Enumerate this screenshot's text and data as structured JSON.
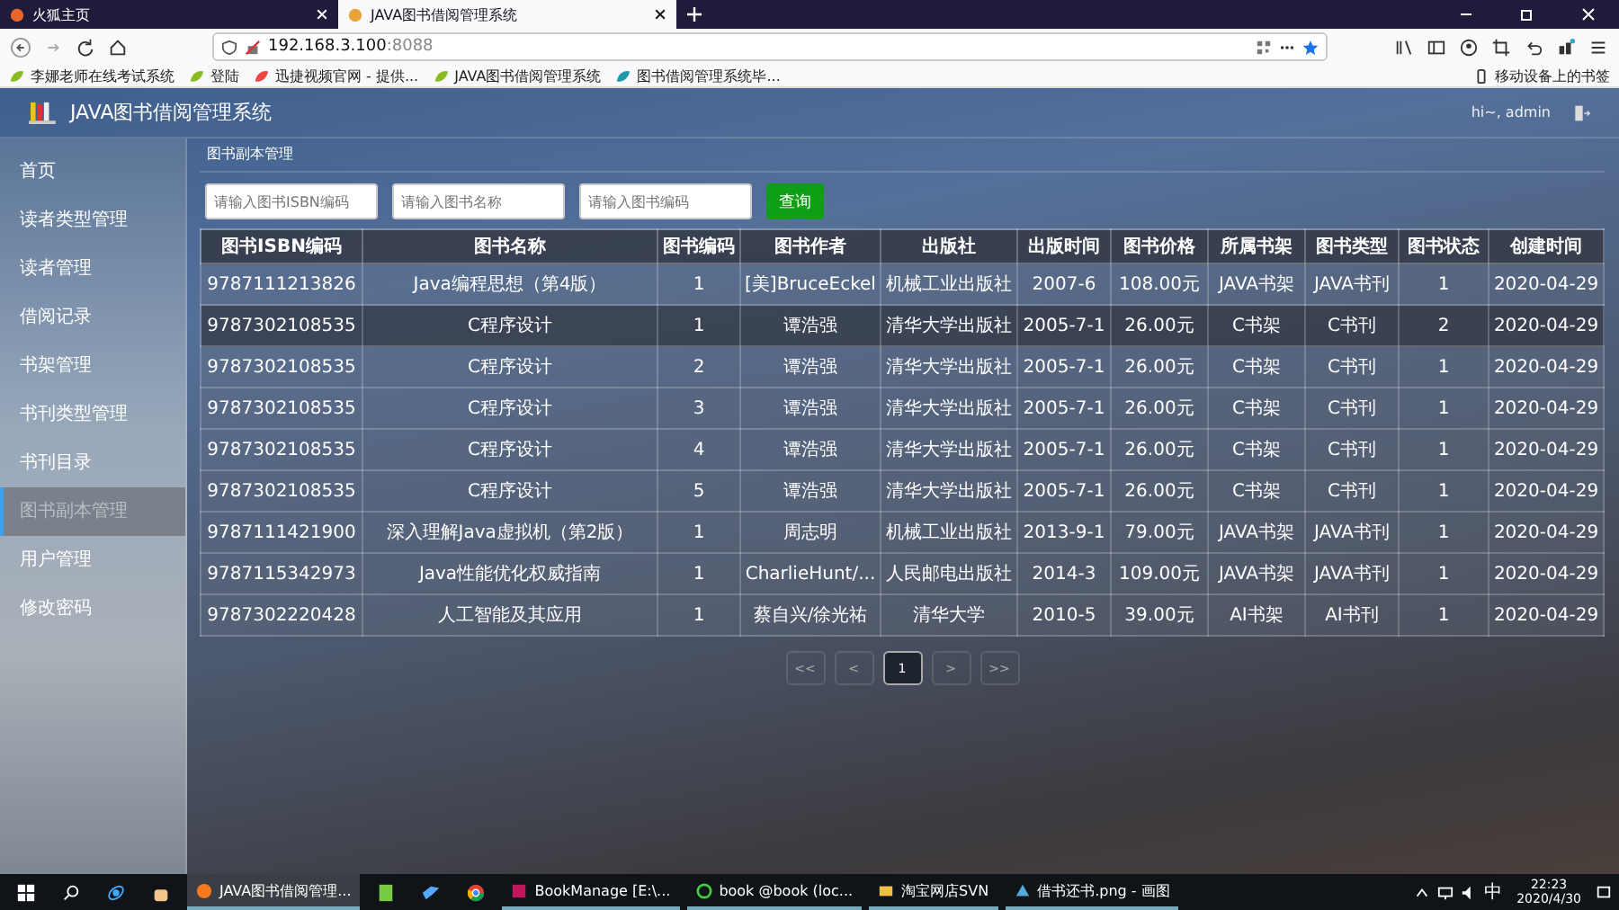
{
  "browser": {
    "tabs": [
      {
        "title": "火狐主页",
        "selected": false
      },
      {
        "title": "JAVA图书借阅管理系统",
        "selected": true
      }
    ],
    "address": {
      "host": "192.168.3.100",
      "port": ":8088"
    },
    "bookmarks": [
      "李娜老师在线考试系统",
      "登陆",
      "迅捷视频官网 - 提供...",
      "JAVA图书借阅管理系统",
      "图书借阅管理系统毕..."
    ],
    "mobile_bookmarks": "移动设备上的书签"
  },
  "app": {
    "title": "JAVA图书借阅管理系统",
    "user": "hi~, admin",
    "sidebar": {
      "items": [
        {
          "label": "首页",
          "selected": false
        },
        {
          "label": "读者类型管理",
          "selected": false
        },
        {
          "label": "读者管理",
          "selected": false
        },
        {
          "label": "借阅记录",
          "selected": false
        },
        {
          "label": "书架管理",
          "selected": false
        },
        {
          "label": "书刊类型管理",
          "selected": false
        },
        {
          "label": "书刊目录",
          "selected": false
        },
        {
          "label": "图书副本管理",
          "selected": true
        },
        {
          "label": "用户管理",
          "selected": false
        },
        {
          "label": "修改密码",
          "selected": false
        }
      ]
    },
    "breadcrumb": "图书副本管理",
    "search": {
      "fields": [
        {
          "placeholder": "请输入图书ISBN编码"
        },
        {
          "placeholder": "请输入图书名称"
        },
        {
          "placeholder": "请输入图书编码"
        }
      ],
      "button": "查询"
    },
    "table": {
      "columns": [
        "图书ISBN编码",
        "图书名称",
        "图书编码",
        "图书作者",
        "出版社",
        "出版时间",
        "图书价格",
        "所属书架",
        "图书类型",
        "图书状态",
        "创建时间"
      ],
      "rows": [
        {
          "selected": false,
          "cells": [
            "9787111213826",
            "Java编程思想（第4版）",
            "1",
            "[美]BruceEckel",
            "机械工业出版社",
            "2007-6",
            "108.00元",
            "JAVA书架",
            "JAVA书刊",
            "1",
            "2020-04-29"
          ]
        },
        {
          "selected": true,
          "cells": [
            "9787302108535",
            "C程序设计",
            "1",
            "谭浩强",
            "清华大学出版社",
            "2005-7-1",
            "26.00元",
            "C书架",
            "C书刊",
            "2",
            "2020-04-29"
          ]
        },
        {
          "selected": false,
          "cells": [
            "9787302108535",
            "C程序设计",
            "2",
            "谭浩强",
            "清华大学出版社",
            "2005-7-1",
            "26.00元",
            "C书架",
            "C书刊",
            "1",
            "2020-04-29"
          ]
        },
        {
          "selected": false,
          "cells": [
            "9787302108535",
            "C程序设计",
            "3",
            "谭浩强",
            "清华大学出版社",
            "2005-7-1",
            "26.00元",
            "C书架",
            "C书刊",
            "1",
            "2020-04-29"
          ]
        },
        {
          "selected": false,
          "cells": [
            "9787302108535",
            "C程序设计",
            "4",
            "谭浩强",
            "清华大学出版社",
            "2005-7-1",
            "26.00元",
            "C书架",
            "C书刊",
            "1",
            "2020-04-29"
          ]
        },
        {
          "selected": false,
          "cells": [
            "9787302108535",
            "C程序设计",
            "5",
            "谭浩强",
            "清华大学出版社",
            "2005-7-1",
            "26.00元",
            "C书架",
            "C书刊",
            "1",
            "2020-04-29"
          ]
        },
        {
          "selected": false,
          "cells": [
            "9787111421900",
            "深入理解Java虚拟机（第2版）",
            "1",
            "周志明",
            "机械工业出版社",
            "2013-9-1",
            "79.00元",
            "JAVA书架",
            "JAVA书刊",
            "1",
            "2020-04-29"
          ]
        },
        {
          "selected": false,
          "cells": [
            "9787115342973",
            "Java性能优化权威指南",
            "1",
            "CharlieHunt/...",
            "人民邮电出版社",
            "2014-3",
            "109.00元",
            "JAVA书架",
            "JAVA书刊",
            "1",
            "2020-04-29"
          ]
        },
        {
          "selected": false,
          "cells": [
            "9787302220428",
            "人工智能及其应用",
            "1",
            "蔡自兴/徐光祐",
            "清华大学",
            "2010-5",
            "39.00元",
            "AI书架",
            "AI书刊",
            "1",
            "2020-04-29"
          ]
        }
      ]
    },
    "pagination": [
      {
        "label": "<<",
        "selected": false
      },
      {
        "label": "<",
        "selected": false
      },
      {
        "label": "1",
        "selected": true
      },
      {
        "label": ">",
        "selected": false
      },
      {
        "label": ">>",
        "selected": false
      }
    ]
  },
  "taskbar": {
    "apps": [
      {
        "label": "JAVA图书借阅管理...",
        "selected": true
      },
      {
        "label": "BookManage [E:\\...",
        "selected": false
      },
      {
        "label": "book @book (loc...",
        "selected": false
      },
      {
        "label": "淘宝网店SVN",
        "selected": false
      },
      {
        "label": "借书还书.png - 画图",
        "selected": false
      }
    ],
    "ime": "中",
    "time": "22:23",
    "date": "2020/4/30"
  }
}
